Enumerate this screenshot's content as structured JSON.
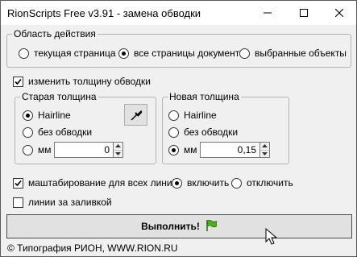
{
  "window": {
    "title": "RionScripts Free v3.91 - замена обводки"
  },
  "scope": {
    "legend": "Область действия",
    "options": [
      "текущая страница",
      "все страницы документа",
      "выбранные объекты"
    ],
    "selected_index": 1
  },
  "change_width": {
    "label": "изменить толщину обводки",
    "checked": true
  },
  "old_width": {
    "legend": "Старая толщина",
    "hairline_label": "Hairline",
    "no_stroke_label": "без обводки",
    "mm_label": "мм",
    "mm_value": "0",
    "selected": "hairline"
  },
  "new_width": {
    "legend": "Новая толщина",
    "hairline_label": "Hairline",
    "no_stroke_label": "без обводки",
    "mm_label": "мм",
    "mm_value": "0,15",
    "selected": "mm"
  },
  "scaling": {
    "label": "маштабирование для всех линий",
    "checked": true,
    "on_label": "включить",
    "off_label": "отключить",
    "selected": "on"
  },
  "lines_behind_fill": {
    "label": "линии за заливкой",
    "checked": false
  },
  "run_button": {
    "label": "Выполнить!"
  },
  "footer": {
    "text": "© Типография РИОН,  WWW.RION.RU"
  },
  "colors": {
    "window_bg": "#f0f0f0",
    "button_bg": "#e1e1e1",
    "flag_green": "#4caf1a"
  }
}
